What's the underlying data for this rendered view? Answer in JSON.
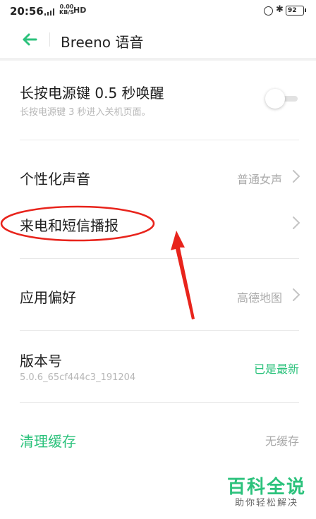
{
  "status_bar": {
    "time": "20:56",
    "network_type": "4G",
    "speed_value": "0.00",
    "speed_unit": "KB/S",
    "hd_label": "HD",
    "battery": "92"
  },
  "header": {
    "title": "Breeno 语音"
  },
  "settings": {
    "power_key": {
      "title": "长按电源键 0.5 秒唤醒",
      "subtitle": "长按电源键 3 秒进入关机页面。",
      "toggle_on": false
    },
    "voice": {
      "title": "个性化声音",
      "value": "普通女声"
    },
    "call_sms": {
      "title": "来电和短信播报"
    },
    "app_pref": {
      "title": "应用偏好",
      "value": "高德地图"
    },
    "version": {
      "title": "版本号",
      "subtitle": "5.0.6_65cf444c3_191204",
      "status": "已是最新"
    },
    "cache": {
      "title": "清理缓存",
      "value": "无缓存"
    }
  },
  "watermark": {
    "main": "百科全说",
    "sub": "助你轻松解决"
  },
  "colors": {
    "accent": "#2cc27c",
    "annotation": "#e8241c"
  }
}
